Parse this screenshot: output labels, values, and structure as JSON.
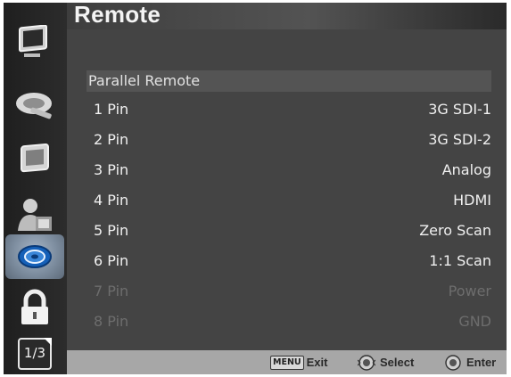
{
  "header": {
    "title": "Remote"
  },
  "sidebar": {
    "page_indicator": "1/3",
    "items": [
      {
        "icon": "monitor-icon"
      },
      {
        "icon": "satellite-dish-icon"
      },
      {
        "icon": "display-icon"
      },
      {
        "icon": "user-settings-icon"
      },
      {
        "icon": "remote-disc-icon",
        "active": true
      },
      {
        "icon": "lock-icon"
      }
    ]
  },
  "section": {
    "title": "Parallel Remote"
  },
  "pins": [
    {
      "label": "1 Pin",
      "value": "3G SDI-1",
      "enabled": true
    },
    {
      "label": "2 Pin",
      "value": "3G SDI-2",
      "enabled": true
    },
    {
      "label": "3 Pin",
      "value": "Analog",
      "enabled": true
    },
    {
      "label": "4 Pin",
      "value": "HDMI",
      "enabled": true
    },
    {
      "label": "5 Pin",
      "value": "Zero Scan",
      "enabled": true
    },
    {
      "label": "6 Pin",
      "value": "1:1 Scan",
      "enabled": true
    },
    {
      "label": "7 Pin",
      "value": "Power",
      "enabled": false
    },
    {
      "label": "8 Pin",
      "value": "GND",
      "enabled": false
    }
  ],
  "footer": {
    "menu_key": "MENU",
    "exit_label": "Exit",
    "select_label": "Select",
    "enter_label": "Enter"
  }
}
